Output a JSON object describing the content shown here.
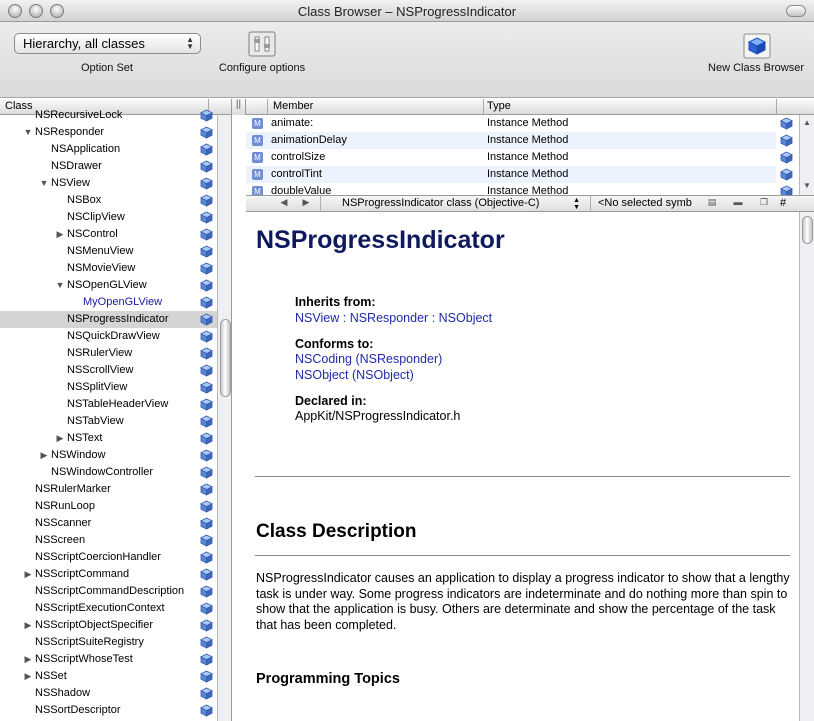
{
  "window": {
    "title": "Class Browser – NSProgressIndicator"
  },
  "toolbar": {
    "option_set_value": "Hierarchy, all classes",
    "option_set_label": "Option Set",
    "configure_label": "Configure options",
    "new_browser_label": "New Class Browser"
  },
  "class_pane": {
    "header": "Class",
    "rows": [
      {
        "label": "NSRecursiveLock",
        "indent": 0,
        "triangle": "none"
      },
      {
        "label": "NSResponder",
        "indent": 0,
        "triangle": "open"
      },
      {
        "label": "NSApplication",
        "indent": 1,
        "triangle": "none"
      },
      {
        "label": "NSDrawer",
        "indent": 1,
        "triangle": "none"
      },
      {
        "label": "NSView",
        "indent": 1,
        "triangle": "open"
      },
      {
        "label": "NSBox",
        "indent": 2,
        "triangle": "none"
      },
      {
        "label": "NSClipView",
        "indent": 2,
        "triangle": "none"
      },
      {
        "label": "NSControl",
        "indent": 2,
        "triangle": "closed"
      },
      {
        "label": "NSMenuView",
        "indent": 2,
        "triangle": "none"
      },
      {
        "label": "NSMovieView",
        "indent": 2,
        "triangle": "none"
      },
      {
        "label": "NSOpenGLView",
        "indent": 2,
        "triangle": "open"
      },
      {
        "label": "MyOpenGLView",
        "indent": 3,
        "triangle": "none",
        "link": true
      },
      {
        "label": "NSProgressIndicator",
        "indent": 2,
        "triangle": "none",
        "selected": true
      },
      {
        "label": "NSQuickDrawView",
        "indent": 2,
        "triangle": "none"
      },
      {
        "label": "NSRulerView",
        "indent": 2,
        "triangle": "none"
      },
      {
        "label": "NSScrollView",
        "indent": 2,
        "triangle": "none"
      },
      {
        "label": "NSSplitView",
        "indent": 2,
        "triangle": "none"
      },
      {
        "label": "NSTableHeaderView",
        "indent": 2,
        "triangle": "none"
      },
      {
        "label": "NSTabView",
        "indent": 2,
        "triangle": "none"
      },
      {
        "label": "NSText",
        "indent": 2,
        "triangle": "closed"
      },
      {
        "label": "NSWindow",
        "indent": 1,
        "triangle": "closed"
      },
      {
        "label": "NSWindowController",
        "indent": 1,
        "triangle": "none"
      },
      {
        "label": "NSRulerMarker",
        "indent": 0,
        "triangle": "none"
      },
      {
        "label": "NSRunLoop",
        "indent": 0,
        "triangle": "none"
      },
      {
        "label": "NSScanner",
        "indent": 0,
        "triangle": "none"
      },
      {
        "label": "NSScreen",
        "indent": 0,
        "triangle": "none"
      },
      {
        "label": "NSScriptCoercionHandler",
        "indent": 0,
        "triangle": "none"
      },
      {
        "label": "NSScriptCommand",
        "indent": 0,
        "triangle": "closed"
      },
      {
        "label": "NSScriptCommandDescription",
        "indent": 0,
        "triangle": "none"
      },
      {
        "label": "NSScriptExecutionContext",
        "indent": 0,
        "triangle": "none"
      },
      {
        "label": "NSScriptObjectSpecifier",
        "indent": 0,
        "triangle": "closed"
      },
      {
        "label": "NSScriptSuiteRegistry",
        "indent": 0,
        "triangle": "none"
      },
      {
        "label": "NSScriptWhoseTest",
        "indent": 0,
        "triangle": "closed"
      },
      {
        "label": "NSSet",
        "indent": 0,
        "triangle": "closed"
      },
      {
        "label": "NSShadow",
        "indent": 0,
        "triangle": "none"
      },
      {
        "label": "NSSortDescriptor",
        "indent": 0,
        "triangle": "none"
      }
    ]
  },
  "member_table": {
    "col_member": "Member",
    "col_type": "Type",
    "rows": [
      {
        "name": "animate:",
        "type": "Instance Method"
      },
      {
        "name": "animationDelay",
        "type": "Instance Method"
      },
      {
        "name": "controlSize",
        "type": "Instance Method"
      },
      {
        "name": "controlTint",
        "type": "Instance Method"
      },
      {
        "name": "doubleValue",
        "type": "Instance Method"
      }
    ]
  },
  "navbar": {
    "class_popup": "NSProgressIndicator class (Objective-C)",
    "symbol_popup": "<No selected symb",
    "hash": "#"
  },
  "doc": {
    "title": "NSProgressIndicator",
    "inherits_label": "Inherits from:",
    "inherits": [
      "NSView",
      "NSResponder",
      "NSObject"
    ],
    "inherits_sep": ":",
    "conforms_label": "Conforms to:",
    "conforms": [
      "NSCoding (NSResponder)",
      "NSObject (NSObject)"
    ],
    "declared_label": "Declared in:",
    "declared": "AppKit/NSProgressIndicator.h",
    "class_desc_heading": "Class Description",
    "class_desc": "NSProgressIndicator causes an application to display a progress indicator to show that a lengthy task is under way. Some progress indicators are indeterminate and do nothing more than spin to show that the application is busy. Others are determinate and show the percentage of the task that has been completed.",
    "topics_heading": "Programming Topics"
  },
  "colors": {
    "doc_title": "#0f1a5e",
    "link": "#1f2aa8",
    "selection": "#d4d4d4",
    "row_alt": "#edf3fe"
  },
  "icons": {
    "class_row": "cube-icon",
    "member": "method-icon",
    "new_browser": "cube-icon",
    "configure": "switches-icon"
  }
}
